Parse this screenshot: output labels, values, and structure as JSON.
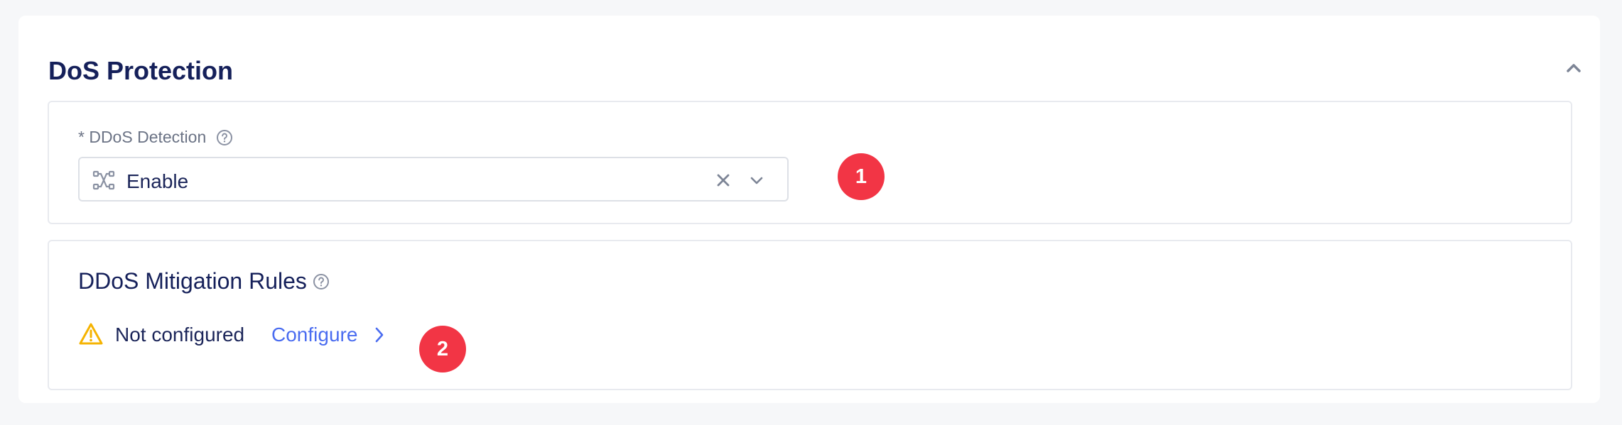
{
  "section": {
    "title": "DoS Protection"
  },
  "ddos_detection": {
    "label": "* DDoS Detection",
    "selected_value": "Enable",
    "icons": [
      "network-icon",
      "help-icon",
      "clear-icon",
      "chevron-down-icon"
    ]
  },
  "mitigation": {
    "title": "DDoS Mitigation Rules",
    "status": "Not configured",
    "configure_label": "Configure",
    "icons": [
      "warning-icon",
      "help-icon",
      "chevron-right-icon"
    ]
  },
  "annotations": {
    "badge_1": "1",
    "badge_2": "2"
  },
  "colors": {
    "title": "#15205a",
    "link": "#4a6cf0",
    "badge": "#f23545",
    "warning": "#f5b301",
    "border": "#e8eaef"
  }
}
